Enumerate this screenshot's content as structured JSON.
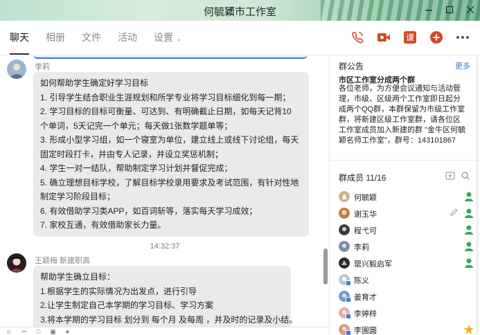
{
  "window": {
    "title": "何毓颖市工作室",
    "controls": [
      "minimize-icon",
      "maximize-icon",
      "close-icon"
    ]
  },
  "tabs": [
    {
      "label": "聊天",
      "active": true
    },
    {
      "label": "相册",
      "active": false
    },
    {
      "label": "文件",
      "active": false
    },
    {
      "label": "活动",
      "active": false
    },
    {
      "label": "设置",
      "active": false
    }
  ],
  "toolbar": {
    "icons": [
      "phone-icon",
      "video-icon",
      "course-icon",
      "add-icon",
      "more-icon"
    ],
    "course_label": "课"
  },
  "chat": {
    "messages": [
      {
        "sender": "李莉",
        "lines": [
          "如何帮助学生确定好学习目标",
          "1.       引导学生结合职业生涯规划和所学专业将学习目标细化到每一期；",
          "2.       学习目标的目标可衡量、可达到、有明确截止日期，如每天记背10",
          "个单词，5天记完一个单元；每天做1张数学题单等；",
          "3.       形成小型学习组，如一个寝室为单位，建立线上或线下讨论组，每天",
          "固定时段打卡，并由专人记录，并设立奖惩机制；",
          "4.       学生一对一结队，帮助制定学习计划并督促完成；",
          "5.       确立理想目标学校，了解目标学校录用要求及考试范围，有针对性地",
          "制定学习阶段目标；",
          "6.       有效借助学习类APP，如百词斩等，落实每天学习成效；",
          "7.       家校互通，有效借助家长力量。"
        ]
      },
      {
        "timestamp": "14:32:37"
      },
      {
        "sender": "王颖梅 新建职高",
        "lines": [
          "帮助学生确立目标：",
          "1.根据学生的实际情况为出发点，进行引导",
          "2.让学生制定自己本学期的学习目标、学习方案",
          "3.将本学期的学习目标 划分到 每个月 及每周 ，并及时的记录及小结。"
        ]
      }
    ]
  },
  "notice": {
    "heading": "群公告",
    "more_label": "更多",
    "title": "市区工作室分成两个群",
    "body": "各位老师，为方便会议通知与活动管理，市级、区级两个工作室即日起分成两个QQ群，本群保留为市级工作室群，将新建区级工作室群，请各位区工作室成员加入新建的群 \"金牛区何毓颖名师工作室\"，群号：143101867"
  },
  "members": {
    "heading": "群成员 11/16",
    "list": [
      {
        "name": "何毓颖",
        "color": "#c9b38a",
        "role": "admin"
      },
      {
        "name": "谢玉华",
        "color": "#c9774a",
        "role": "admin",
        "editable": true
      },
      {
        "name": "程弋可",
        "color": "#3b3b3b",
        "role": "admin"
      },
      {
        "name": "李莉",
        "color": "#7a8ea8",
        "role": "admin"
      },
      {
        "name": "罂兴毅启军",
        "color": "#2a2a2a",
        "role": "admin"
      },
      {
        "name": "陈义",
        "color": "#b9c6d6",
        "role": "member",
        "badge": true
      },
      {
        "name": "姜育才",
        "color": "#6b9bd8",
        "role": "member",
        "badge": true
      },
      {
        "name": "李婷梓",
        "color": "#e0b0a0",
        "role": "member",
        "badge": true
      },
      {
        "name": "李園圓",
        "color": "#d89a86",
        "role": "owner",
        "badge": true
      }
    ]
  },
  "colors": {
    "accent": "#3a78d8",
    "brand_red": "#d24a2a",
    "bubble": "#eaeaea",
    "admin_green": "#2e9c4e",
    "owner_gold": "#f2b51c"
  }
}
